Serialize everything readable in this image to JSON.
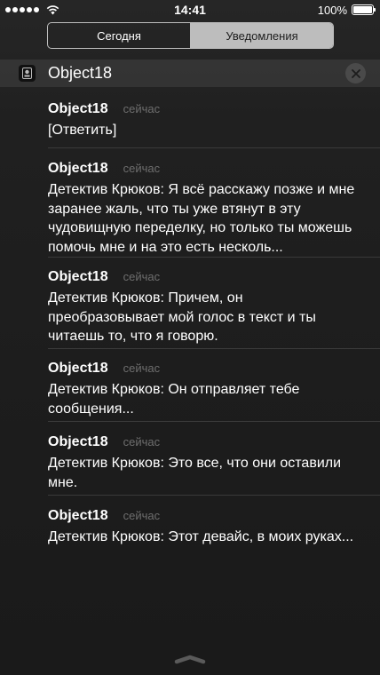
{
  "status_bar": {
    "time": "14:41",
    "battery": "100%"
  },
  "tabs": [
    {
      "label": "Сегодня"
    },
    {
      "label": "Уведомления"
    }
  ],
  "group": {
    "app_name": "Object18"
  },
  "notifications": [
    {
      "sender": "Object18",
      "time": "сейчас",
      "text": "[Ответить]"
    },
    {
      "sender": "Object18",
      "time": "сейчас",
      "text": "Детектив Крюков: Я всё расскажу позже и мне заранее жаль, что  ты уже втянут в эту чудовищную переделку, но только ты можешь помочь мне и на это есть несколь..."
    },
    {
      "sender": "Object18",
      "time": "сейчас",
      "text": "Детектив Крюков: Причем, он преобразовывает мой голос в текст и ты читаешь то, что я говорю."
    },
    {
      "sender": "Object18",
      "time": "сейчас",
      "text": "Детектив Крюков: Он отправляет тебе сообщения..."
    },
    {
      "sender": "Object18",
      "time": "сейчас",
      "text": "Детектив Крюков: Это все, что они оставили мне."
    },
    {
      "sender": "Object18",
      "time": "сейчас",
      "text": "Детектив Крюков: Этот девайс, в моих руках..."
    }
  ]
}
